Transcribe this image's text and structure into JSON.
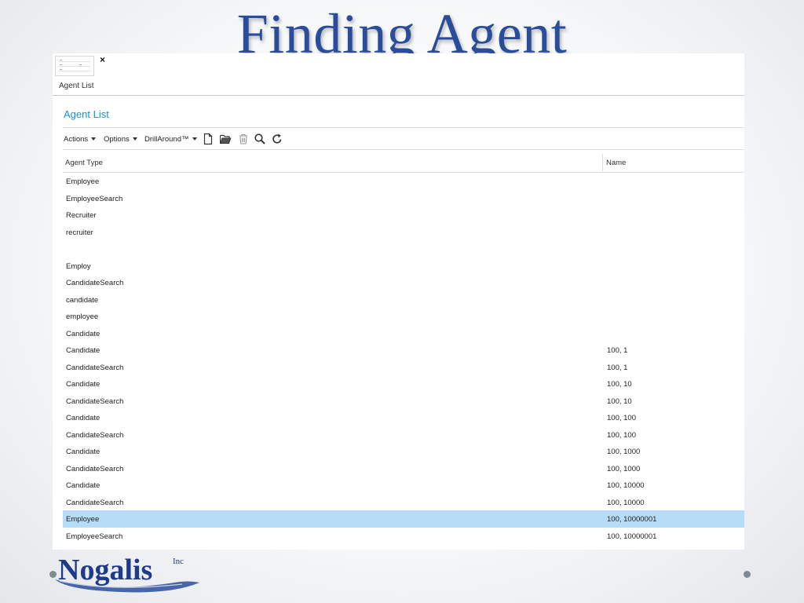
{
  "slide": {
    "title": "Finding Agent",
    "logo_text": "Nogalis",
    "logo_suffix": "Inc"
  },
  "tab": {
    "close_symbol": "×",
    "label": "Agent List"
  },
  "panel": {
    "title": "Agent List",
    "accent_color": "#1a8ed6"
  },
  "toolbar": {
    "actions_label": "Actions",
    "options_label": "Options",
    "drillaround_label": "DrillAround™",
    "icons": [
      "new-document-icon",
      "open-folder-icon",
      "delete-trash-icon",
      "search-icon",
      "refresh-icon"
    ]
  },
  "grid": {
    "columns": [
      "Agent Type",
      "Name"
    ],
    "selected_row_color": "#b6dcf7",
    "rows": [
      {
        "type": "Employee",
        "name": ""
      },
      {
        "type": "EmployeeSearch",
        "name": ""
      },
      {
        "type": "Recruiter",
        "name": ""
      },
      {
        "type": "recruiter",
        "name": ""
      },
      {
        "type": "",
        "name": ""
      },
      {
        "type": "Employ",
        "name": ""
      },
      {
        "type": "CandidateSearch",
        "name": ""
      },
      {
        "type": "candidate",
        "name": ""
      },
      {
        "type": "employee",
        "name": ""
      },
      {
        "type": "Candidate",
        "name": ""
      },
      {
        "type": "Candidate",
        "name": "100, 1"
      },
      {
        "type": "CandidateSearch",
        "name": "100, 1"
      },
      {
        "type": "Candidate",
        "name": "100, 10"
      },
      {
        "type": "CandidateSearch",
        "name": "100, 10"
      },
      {
        "type": "Candidate",
        "name": "100, 100"
      },
      {
        "type": "CandidateSearch",
        "name": "100, 100"
      },
      {
        "type": "Candidate",
        "name": "100, 1000"
      },
      {
        "type": "CandidateSearch",
        "name": "100, 1000"
      },
      {
        "type": "Candidate",
        "name": "100, 10000"
      },
      {
        "type": "CandidateSearch",
        "name": "100, 10000"
      },
      {
        "type": "Employee",
        "name": "100, 10000001",
        "selected": true
      },
      {
        "type": "EmployeeSearch",
        "name": "100, 10000001"
      }
    ]
  }
}
